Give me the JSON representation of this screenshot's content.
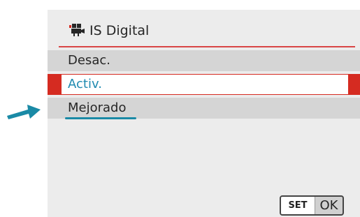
{
  "header": {
    "title": "IS Digital",
    "icon": "movie-camera-icon"
  },
  "menu": {
    "items": [
      {
        "label": "Desac.",
        "selected": false
      },
      {
        "label": "Activ.",
        "selected": true
      },
      {
        "label": "Mejorado",
        "selected": false
      }
    ]
  },
  "footer": {
    "set_label": "SET",
    "ok_label": "OK"
  },
  "colors": {
    "accent_red": "#d52b21",
    "selected_text": "#1f8ab0",
    "annotation_arrow": "#1a8aa6"
  }
}
